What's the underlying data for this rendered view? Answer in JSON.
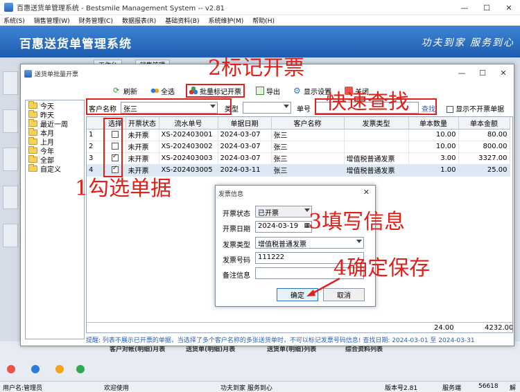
{
  "app": {
    "title": "百惠送货单管理系统 - Bestsmile Management System -- v2.81",
    "brand": "百惠送货单管理系统",
    "slogan": "功夫到家 服务到心",
    "menu": [
      "系统(S)",
      "销售管理(W)",
      "财务管理(C)",
      "数据报表(R)",
      "基础资料(B)",
      "系统维护(M)",
      "帮助(H)"
    ],
    "tabs": [
      "工作台",
      "销售管理"
    ],
    "bottom_items": [
      "客户对帐(明细)月表",
      "送货单(明细)月表",
      "送货单(明细)列表",
      "综合资料列表"
    ]
  },
  "status_bar": {
    "user": "用户名:管理员",
    "welcome": "欢迎使用",
    "slogan": "功夫到家 服务到心",
    "version": "版本号2.81",
    "server_label": "服务端",
    "port": "56618",
    "extra": "解"
  },
  "batch_window": {
    "title": "送货单批量开票",
    "toolbar": {
      "refresh": "刷新",
      "select_all": "全选",
      "batch_mark": "批量标记开票",
      "export": "导出",
      "display_settings": "显示设置",
      "close": "关闭"
    },
    "date_tree": [
      "今天",
      "昨天",
      "最近一周",
      "本月",
      "上月",
      "今年",
      "全部",
      "自定义"
    ],
    "filters": {
      "customer_label": "客户名称",
      "customer_value": "张三",
      "type_label": "类型",
      "type_value": "",
      "number_label": "单号",
      "search_button": "查找",
      "hide_invoiced_label": "显示不开票单据"
    },
    "grid": {
      "headers": [
        "选择",
        "开票状态",
        "流水单号",
        "单据日期",
        "客户名称",
        "发票类型",
        "单本数量",
        "单本金额"
      ],
      "rows": [
        {
          "no": "1",
          "checked": false,
          "status": "未开票",
          "serial": "XS-202403001",
          "date": "2024-03-07",
          "customer": "张三",
          "inv_type": "",
          "qty": "10.00",
          "amount": "80.00"
        },
        {
          "no": "2",
          "checked": false,
          "status": "未开票",
          "serial": "XS-202403002",
          "date": "2024-03-07",
          "customer": "张三",
          "inv_type": "",
          "qty": "10.00",
          "amount": "800.00"
        },
        {
          "no": "3",
          "checked": true,
          "status": "未开票",
          "serial": "XS-202403003",
          "date": "2024-03-07",
          "customer": "张三",
          "inv_type": "增值税普通发票",
          "qty": "3.00",
          "amount": "3327.00"
        },
        {
          "no": "4",
          "checked": true,
          "status": "未开票",
          "serial": "XS-202403005",
          "date": "2024-03-11",
          "customer": "张三",
          "inv_type": "增值税普通发票",
          "qty": "1.00",
          "amount": "25.00"
        }
      ],
      "total_qty": "24.00",
      "total_amount": "4232.00"
    },
    "hint": "提醒: 列表不展示已开票的单据，当选择了多个客户名称的多张送货单时，不可以标记发票号码信息!   查找日期: 2024-03-01 至 2024-03-31"
  },
  "invoice_dialog": {
    "title": "发票信息",
    "status_label": "开票状态",
    "status_value": "已开票",
    "date_label": "开票日期",
    "date_value": "2024-03-19",
    "type_label": "发票类型",
    "type_value": "增值税普通发票",
    "number_label": "发票号码",
    "number_value": "111222",
    "remark_label": "备注信息",
    "remark_value": "",
    "ok_button": "确定",
    "cancel_button": "取消"
  },
  "annotations": {
    "step1": "1勾选单据",
    "step2": "2标记开票",
    "step3": "3填写信息",
    "step4": "4确定保存",
    "search": "快速查找",
    "color": "#e0201a"
  }
}
